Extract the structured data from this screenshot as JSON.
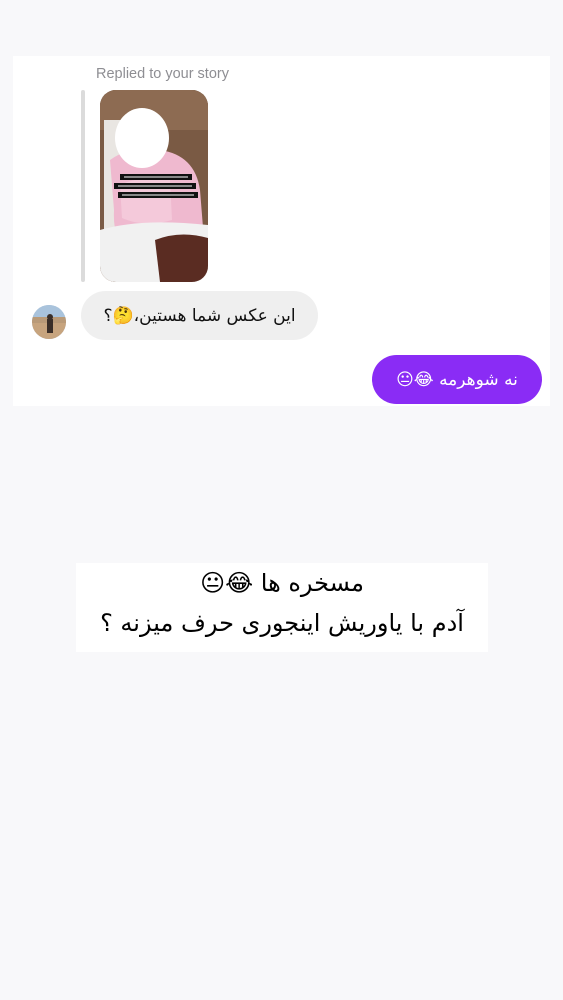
{
  "reply_context": {
    "label": "Replied to your story"
  },
  "messages": {
    "incoming_text": "این عکس شما هستین،🤔؟",
    "outgoing_text": "نه شوهرمه 😂😐"
  },
  "caption": {
    "line1": "مسخره ها 😂😐",
    "line2": "آدم با یاوریش اینجوری حرف میزنه ؟"
  },
  "colors": {
    "outgoing_bubble": "#8a2cf5",
    "incoming_bubble": "#efefef",
    "page_background": "#f8f8fa"
  }
}
